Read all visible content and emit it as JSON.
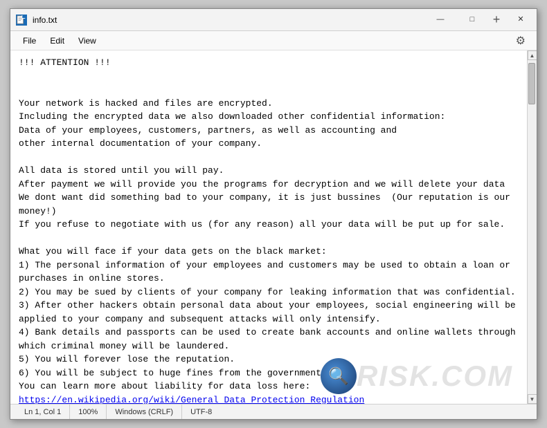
{
  "window": {
    "title": "info.txt",
    "icon": "notepad-icon"
  },
  "titlebar": {
    "title": "info.txt",
    "minimize_label": "—",
    "maximize_label": "□",
    "close_label": "✕",
    "new_tab_label": "+"
  },
  "menubar": {
    "items": [
      "File",
      "Edit",
      "View"
    ],
    "gear_label": "⚙"
  },
  "content": {
    "text": "!!! ATTENTION !!!\n\n\nYour network is hacked and files are encrypted.\nIncluding the encrypted data we also downloaded other confidential information:\nData of your employees, customers, partners, as well as accounting and\nother internal documentation of your company.\n\nAll data is stored until you will pay.\nAfter payment we will provide you the programs for decryption and we will delete your data\nWe dont want did something bad to your company, it is just bussines  (Our reputation is our money!)\nIf you refuse to negotiate with us (for any reason) all your data will be put up for sale.\n\nWhat you will face if your data gets on the black market:\n1) The personal information of your employees and customers may be used to obtain a loan or\npurchases in online stores.\n2) You may be sued by clients of your company for leaking information that was confidential.\n3) After other hackers obtain personal data about your employees, social engineering will be\napplied to your company and subsequent attacks will only intensify.\n4) Bank details and passports can be used to create bank accounts and online wallets through\nwhich criminal money will be laundered.\n5) You will forever lose the reputation.\n6) You will be subject to huge fines from the government.\nYou can learn more about liability for data loss here:\nhttps://en.wikipedia.org/wiki/General_Data_Protection_Regulation\nhttps://gdpr-info.eu/\nLosses, fines and the inability to use important files will lead you to huge losses."
  },
  "statusbar": {
    "position": "Ln 1, Col 1",
    "chars": "100%",
    "line_ending": "Windows (CRLF)",
    "encoding": "UTF-8"
  },
  "watermark": {
    "text": "RISK.COM"
  }
}
